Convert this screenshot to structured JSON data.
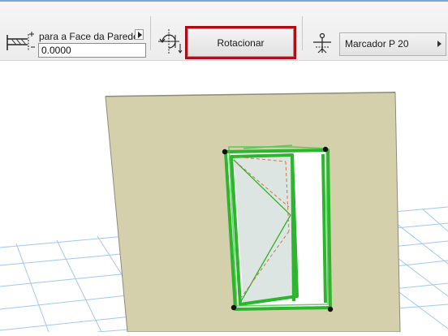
{
  "toolbar": {
    "anchor_label": "para a Face da Parede",
    "offset_value": "0.0000",
    "rotate_button_label": "Rotacionar",
    "marker_value": "Marcador P 20"
  },
  "icons": {
    "anchor": "wall-face-anchor-icon",
    "arrow": "arrow-right-icon",
    "rotation": "rotation-plane-icon",
    "marker": "marker-symbol-icon",
    "dropdown": "chevron-right-icon"
  },
  "colors": {
    "highlight": "#b4121c",
    "wall": "#d4d0ac",
    "selection": "#22aa22",
    "grid": "#9fc9f2"
  }
}
